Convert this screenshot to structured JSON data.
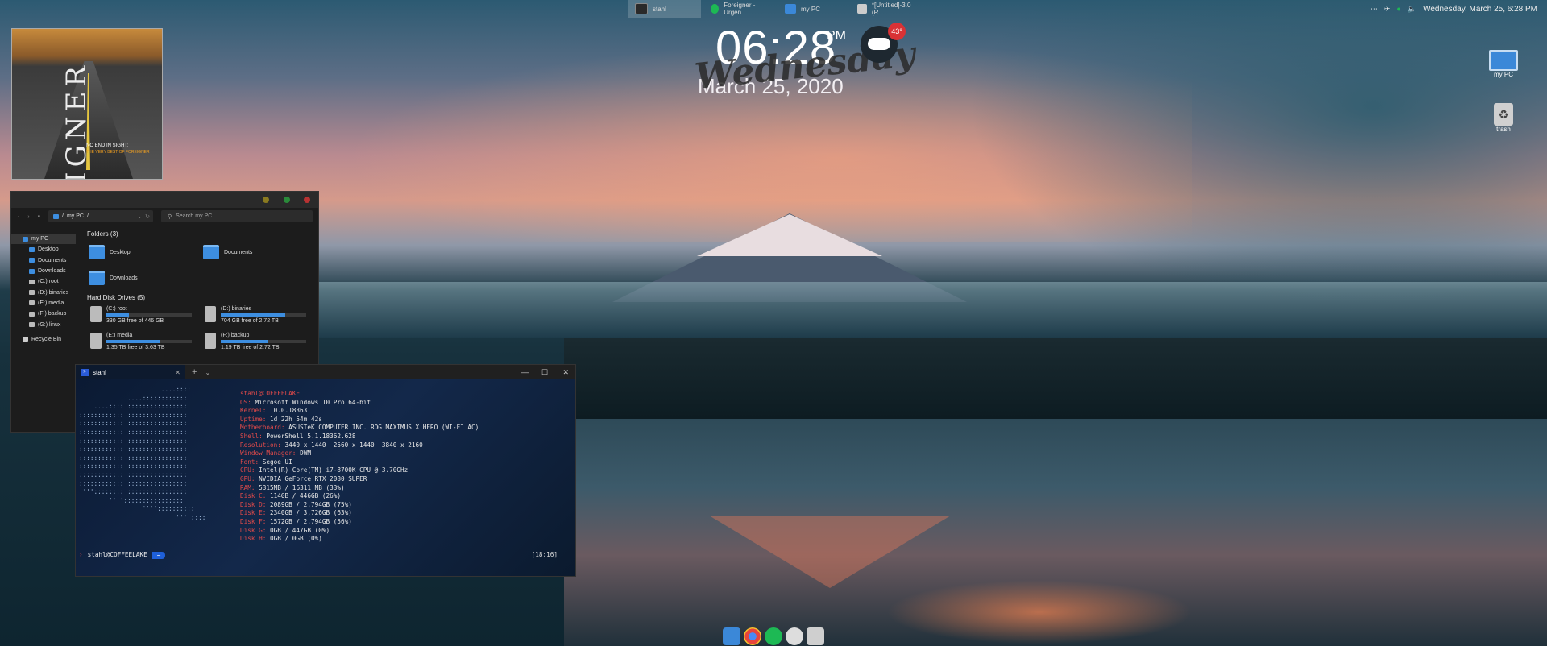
{
  "taskbar": {
    "tasks": [
      {
        "label": "stahl",
        "icon": "terminal-icon",
        "color": "#2a2a2a"
      },
      {
        "label": "Foreigner - Urgen...",
        "icon": "spotify-icon",
        "color": "#1db954"
      },
      {
        "label": "my PC",
        "icon": "monitor-icon",
        "color": "#3b88d8"
      },
      {
        "label": "*[Untitled]-3.0 (R...",
        "icon": "app-icon",
        "color": "#cccccc"
      }
    ],
    "datetime": "Wednesday, March 25, 6:28 PM"
  },
  "clock": {
    "time": "06:28",
    "ampm": "PM",
    "day": "Wednesday",
    "date": "March 25, 2020"
  },
  "weather": {
    "temp": "43°",
    "icon": "cloud-icon"
  },
  "album": {
    "title_art": "FOREIGNER",
    "line1": "NO END IN SIGHT:",
    "line2": "THE VERY BEST OF FOREIGNER"
  },
  "desktop_icons": [
    {
      "label": "my PC"
    },
    {
      "label": "trash"
    }
  ],
  "explorer": {
    "path_root": "my PC",
    "path_sep": "/",
    "search_placeholder": "Search my PC",
    "sidebar": [
      {
        "label": "my PC",
        "level": 0,
        "selected": true,
        "color": "#3d8ee0"
      },
      {
        "label": "Desktop",
        "level": 1,
        "color": "#3d8ee0"
      },
      {
        "label": "Documents",
        "level": 1,
        "color": "#3d8ee0"
      },
      {
        "label": "Downloads",
        "level": 1,
        "color": "#3d8ee0"
      },
      {
        "label": "(C:) root",
        "level": 1,
        "color": "#bbbbbb"
      },
      {
        "label": "(D:) binaries",
        "level": 1,
        "color": "#bbbbbb"
      },
      {
        "label": "(E:) media",
        "level": 1,
        "color": "#bbbbbb"
      },
      {
        "label": "(F:) backup",
        "level": 1,
        "color": "#bbbbbb"
      },
      {
        "label": "(G:) linux",
        "level": 1,
        "color": "#bbbbbb"
      },
      {
        "label": "Recycle Bin",
        "level": 0,
        "color": "#cccccc"
      }
    ],
    "folders_heading": "Folders (3)",
    "folders": [
      "Desktop",
      "Documents",
      "Downloads"
    ],
    "drives_heading": "Hard Disk Drives (5)",
    "drives": [
      {
        "name": "(C:) root",
        "free": "330 GB free of 446 GB",
        "used": 0.26
      },
      {
        "name": "(D:) binaries",
        "free": "704 GB free of 2.72 TB",
        "used": 0.75
      },
      {
        "name": "(E:) media",
        "free": "1.35 TB free of 3.63 TB",
        "used": 0.63
      },
      {
        "name": "(F:) backup",
        "free": "1.19 TB free of 2.72 TB",
        "used": 0.56
      }
    ]
  },
  "terminal": {
    "tab_title": "stahl",
    "logo": "                      ....::::\n             ....::::::::::::\n    ....:::: ::::::::::::::::\n:::::::::::: ::::::::::::::::\n:::::::::::: ::::::::::::::::\n:::::::::::: ::::::::::::::::\n:::::::::::: ::::::::::::::::\n:::::::::::: ::::::::::::::::\n:::::::::::: ::::::::::::::::\n:::::::::::: ::::::::::::::::\n:::::::::::: ::::::::::::::::\n:::::::::::: ::::::::::::::::\n'''':::::::: ::::::::::::::::\n        ''''::::::::::::::::\n                 ''''::::::::::\n                          ''''::::",
    "host": "stahl@COFFEELAKE",
    "info": [
      {
        "k": "OS: ",
        "v": "Microsoft Windows 10 Pro 64-bit"
      },
      {
        "k": "Kernel: ",
        "v": "10.0.18363"
      },
      {
        "k": "Uptime: ",
        "v": "1d 22h 54m 42s"
      },
      {
        "k": "Motherboard: ",
        "v": "ASUSTeK COMPUTER INC. ROG MAXIMUS X HERO (WI-FI AC)"
      },
      {
        "k": "Shell: ",
        "v": "PowerShell 5.1.18362.628"
      },
      {
        "k": "Resolution: ",
        "v": "3440 x 1440  2560 x 1440  3840 x 2160"
      },
      {
        "k": "Window Manager: ",
        "v": "DWM"
      },
      {
        "k": "Font: ",
        "v": "Segoe UI"
      },
      {
        "k": "CPU: ",
        "v": "Intel(R) Core(TM) i7-8700K CPU @ 3.70GHz"
      },
      {
        "k": "GPU: ",
        "v": "NVIDIA GeForce RTX 2080 SUPER"
      },
      {
        "k": "RAM: ",
        "v": "5315MB / 16311 MB (33%)"
      },
      {
        "k": "Disk C: ",
        "v": "114GB / 446GB (26%)"
      },
      {
        "k": "Disk D: ",
        "v": "2089GB / 2,794GB (75%)"
      },
      {
        "k": "Disk E: ",
        "v": "2340GB / 3,726GB (63%)"
      },
      {
        "k": "Disk F: ",
        "v": "1572GB / 2,794GB (56%)"
      },
      {
        "k": "Disk G: ",
        "v": "0GB / 447GB (0%)"
      },
      {
        "k": "Disk H: ",
        "v": "0GB / 0GB (0%)"
      }
    ],
    "prompt_user": "stahl@COFFEELAKE",
    "prompt_dir": "~",
    "prompt_time": "[18:16]"
  },
  "dock": [
    {
      "name": "monitor-icon",
      "color": "#3b88d8"
    },
    {
      "name": "chrome-icon",
      "color": "#e8453c"
    },
    {
      "name": "spotify-icon",
      "color": "#1db954"
    },
    {
      "name": "gear-icon",
      "color": "#dddddd"
    },
    {
      "name": "trash-icon",
      "color": "#cfcfcf"
    }
  ]
}
